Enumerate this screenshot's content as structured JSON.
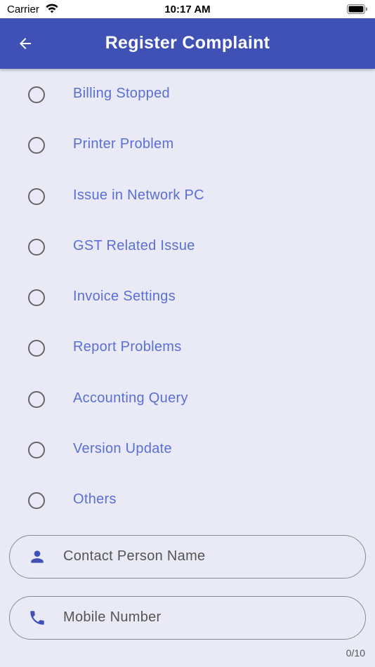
{
  "status_bar": {
    "carrier": "Carrier",
    "time": "10:17 AM"
  },
  "app_bar": {
    "title": "Register Complaint",
    "back_icon": "arrow-left-icon",
    "background": "#3f51b5"
  },
  "options": [
    {
      "label": "Billing Stopped"
    },
    {
      "label": "Printer Problem"
    },
    {
      "label": "Issue in Network PC"
    },
    {
      "label": "GST Related Issue"
    },
    {
      "label": "Invoice Settings"
    },
    {
      "label": "Report Problems"
    },
    {
      "label": "Accounting Query"
    },
    {
      "label": "Version Update"
    },
    {
      "label": "Others"
    }
  ],
  "contact_field": {
    "icon": "person-icon",
    "placeholder": "Contact Person Name",
    "value": ""
  },
  "mobile_field": {
    "icon": "phone-icon",
    "placeholder": "Mobile Number",
    "value": "",
    "counter": "0/10"
  },
  "colors": {
    "accent": "#3f51b5",
    "option_text": "#5a6fd6",
    "background": "#e9eaf5"
  }
}
